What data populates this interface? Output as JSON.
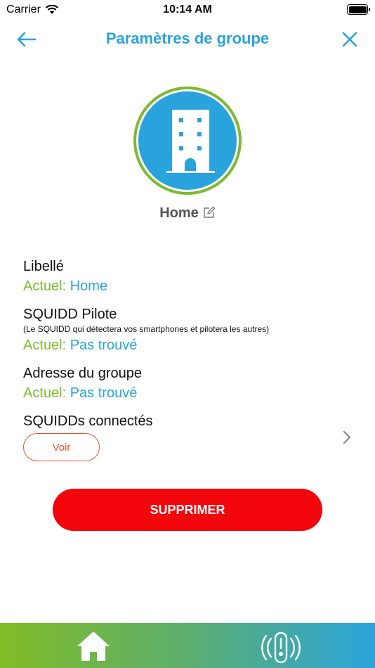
{
  "status_bar": {
    "carrier": "Carrier",
    "time": "10:14 AM"
  },
  "nav": {
    "title": "Paramètres de groupe",
    "back_icon": "arrow-left-icon",
    "close_icon": "close-icon"
  },
  "group": {
    "icon": "building-icon",
    "name": "Home"
  },
  "fields": {
    "libelle": {
      "label": "Libellé",
      "prefix": "Actuel:",
      "value": "Home"
    },
    "pilote": {
      "label": "SQUIDD Pilote",
      "help": "(Le SQUIDD qui détectera vos smartphones et pilotera les autres)",
      "prefix": "Actuel:",
      "value": "Pas trouvé"
    },
    "adresse": {
      "label": "Adresse du groupe",
      "prefix": "Actuel:",
      "value": "Pas trouvé"
    },
    "connectes": {
      "label": "SQUIDDs connectés",
      "button": "Voir"
    }
  },
  "actions": {
    "delete": "SUPPRIMER"
  },
  "colors": {
    "primary_blue": "#29a3dc",
    "accent_green": "#7dbb2c",
    "voir_orange": "#e8532e",
    "delete_red": "#f3050c"
  },
  "tab_bar": {
    "home_icon": "home-icon",
    "device_icon": "squidd-device-icon"
  }
}
